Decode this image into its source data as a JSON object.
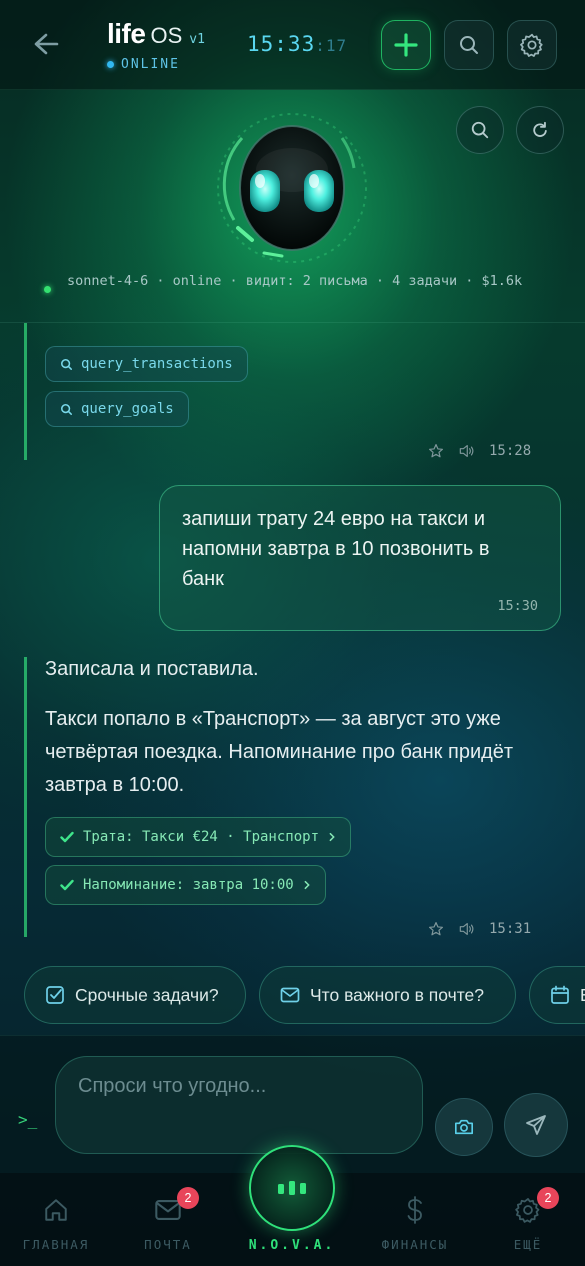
{
  "header": {
    "logo_main": "life",
    "logo_os": "OS",
    "version": "v1",
    "status": "ONLINE",
    "clock_hm": "15:33",
    "clock_sec": ":17",
    "icons": [
      "back-arrow-icon",
      "plus-icon",
      "search-icon",
      "gear-icon"
    ]
  },
  "hero": {
    "model_info": "sonnet-4-6 · online · видит: 2 письма · 4 задачи · $1.6k",
    "icons": [
      "search-icon",
      "refresh-icon"
    ]
  },
  "messages": [
    {
      "role": "assistant",
      "tools": [
        "query_transactions",
        "query_goals"
      ],
      "time": "15:28"
    },
    {
      "role": "user",
      "text": "запиши трату 24 евро на такси и напомни завтра в 10 позвонить в банк",
      "time": "15:30"
    },
    {
      "role": "assistant",
      "paragraphs": [
        "Записала и поставила.",
        "Такси попало в «Транспорт» — за август это уже четвёртая поездка. Напоминание про банк придёт завтра в 10:00."
      ],
      "actions": [
        "Трата: Такси €24 · Транспорт",
        "Напоминание: завтра 10:00"
      ],
      "time": "15:31"
    }
  ],
  "suggestions": [
    "Срочные задачи?",
    "Что важного в почте?",
    "Е"
  ],
  "input": {
    "prompt": ">_",
    "placeholder": "Спроси что угодно..."
  },
  "nav": {
    "home": "ГЛАВНАЯ",
    "mail": "ПОЧТА",
    "mail_badge": "2",
    "nova": "N.O.V.A.",
    "finance": "ФИНАНСЫ",
    "more": "ЕЩЁ",
    "more_badge": "2"
  },
  "colors": {
    "accent_green": "#2fe07a",
    "accent_cyan": "#5ad7f0",
    "badge_red": "#e8455a"
  }
}
